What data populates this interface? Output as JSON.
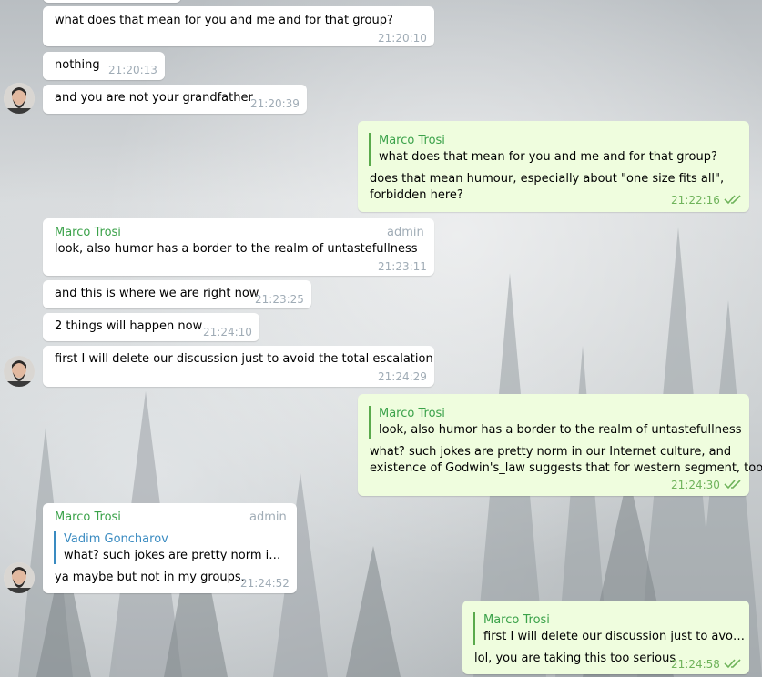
{
  "messages": [
    {
      "text": "what does that mean for you and me and for that group?",
      "time": "21:20:10"
    },
    {
      "text": "nothing",
      "time": "21:20:13"
    },
    {
      "text": "and you are not your grandfather",
      "time": "21:20:39"
    },
    {
      "quote_name": "Marco Trosi",
      "quote_text": "what does that mean for you and me and for that group?",
      "text_line1": "does that mean humour, especially about \"one size fits all\",",
      "text_line2": "forbidden here?",
      "time": "21:22:16"
    },
    {
      "sender": "Marco Trosi",
      "badge": "admin",
      "text": "look, also humor has a border to the realm of untastefullness",
      "time": "21:23:11"
    },
    {
      "text": "and this is where we are right now",
      "time": "21:23:25"
    },
    {
      "text": "2 things will happen now",
      "time": "21:24:10"
    },
    {
      "text": "first I will delete our discussion just to avoid the total escalation",
      "time": "21:24:29"
    },
    {
      "quote_name": "Marco Trosi",
      "quote_text": "look, also humor has a border to the realm of untastefullness",
      "text_line1": "what? such jokes are pretty norm in our Internet culture, and",
      "text_line2": "existence of Godwin's_law suggests that for western segment, too",
      "time": "21:24:30"
    },
    {
      "sender": "Marco Trosi",
      "badge": "admin",
      "quote_name": "Vadim Goncharov",
      "quote_text": "what? such jokes are pretty norm in o...",
      "text": "ya maybe but not in my groups.",
      "time": "21:24:52"
    },
    {
      "quote_name": "Marco Trosi",
      "quote_text": "first I will delete our discussion just to avoid ...",
      "text": "lol, you are taking this too serious",
      "time": "21:24:58"
    }
  ],
  "colors": {
    "incoming": "#ffffff",
    "outgoing": "#effdde",
    "sender": "#3ba24a",
    "reply_blue": "#3a8bc1",
    "check": "#6fb35b"
  },
  "icons": {
    "read": "double-check-icon",
    "avatar": "user-avatar"
  }
}
